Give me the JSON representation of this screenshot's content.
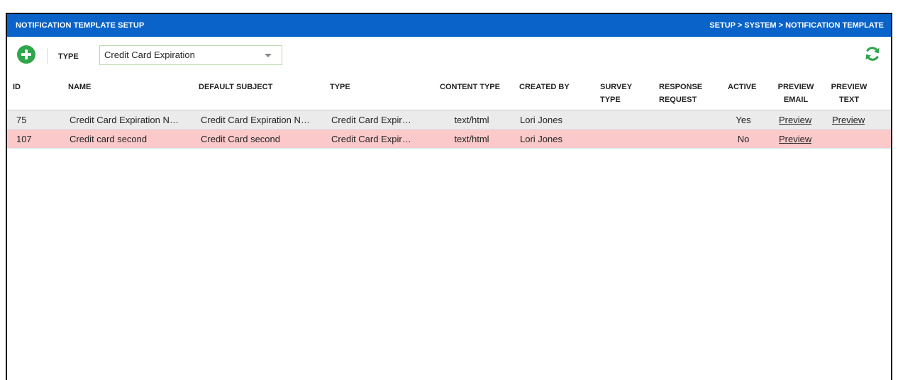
{
  "header": {
    "title": "NOTIFICATION TEMPLATE SETUP",
    "breadcrumb": "SETUP > SYSTEM > NOTIFICATION TEMPLATE",
    "bar_color": "#0a63c9"
  },
  "toolbar": {
    "add_icon": "plus-circle-icon",
    "type_label": "TYPE",
    "type_value": "Credit Card Expiration",
    "refresh_icon": "refresh-icon"
  },
  "table": {
    "columns": [
      {
        "line1": "ID",
        "line2": ""
      },
      {
        "line1": "NAME",
        "line2": ""
      },
      {
        "line1": "DEFAULT SUBJECT",
        "line2": ""
      },
      {
        "line1": "TYPE",
        "line2": ""
      },
      {
        "line1": "CONTENT TYPE",
        "line2": ""
      },
      {
        "line1": "CREATED BY",
        "line2": ""
      },
      {
        "line1": "SURVEY",
        "line2": "TYPE"
      },
      {
        "line1": "RESPONSE",
        "line2": "REQUEST"
      },
      {
        "line1": "ACTIVE",
        "line2": ""
      },
      {
        "line1": "PREVIEW",
        "line2": "EMAIL"
      },
      {
        "line1": "PREVIEW",
        "line2": "TEXT"
      }
    ],
    "rows": [
      {
        "id": "75",
        "name": "Credit Card Expiration N…",
        "subject": "Credit Card Expiration N…",
        "type": "Credit Card Expir…",
        "content_type": "text/html",
        "created_by": "Lori Jones",
        "survey_type": "",
        "response_request": "",
        "active": "Yes",
        "preview_email": "Preview",
        "preview_text": "Preview",
        "row_color": "#ebebeb"
      },
      {
        "id": "107",
        "name": "Credit card second",
        "subject": "Credit Card second",
        "type": "Credit Card Expir…",
        "content_type": "text/html",
        "created_by": "Lori Jones",
        "survey_type": "",
        "response_request": "",
        "active": "No",
        "preview_email": "Preview",
        "preview_text": "",
        "row_color": "#fbc9c9"
      }
    ]
  }
}
